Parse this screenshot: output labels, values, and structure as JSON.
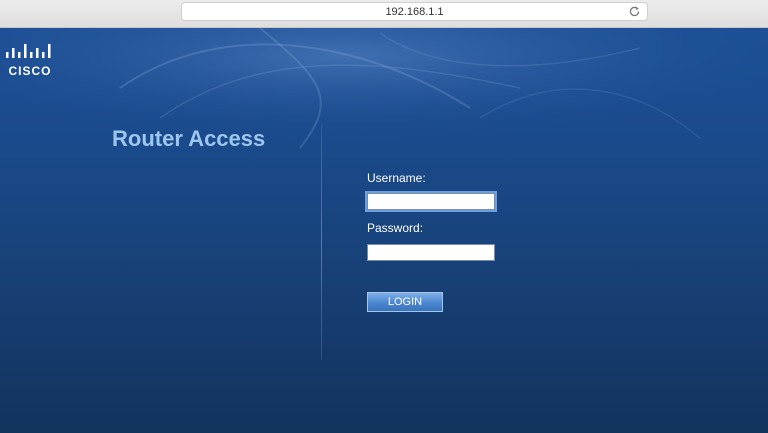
{
  "browser": {
    "url": "192.168.1.1",
    "reload_icon": "reload-icon"
  },
  "brand": {
    "logo_text": "CISCO"
  },
  "login": {
    "title": "Router Access",
    "username_label": "Username:",
    "username_value": "",
    "password_label": "Password:",
    "password_value": "",
    "login_button": "LOGIN"
  },
  "colors": {
    "title": "#9cc6ee",
    "background_top": "#1d4f96",
    "background_bottom": "#12335c",
    "button": "#4b86cf"
  }
}
